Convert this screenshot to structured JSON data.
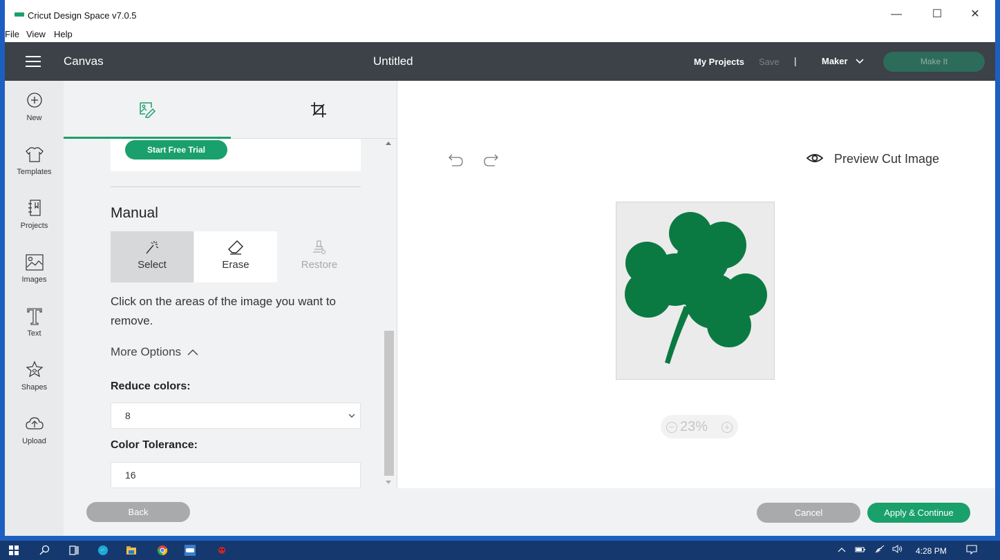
{
  "window": {
    "title": "Cricut Design Space  v7.0.5",
    "menus": [
      "File",
      "View",
      "Help"
    ],
    "controls": {
      "minimize": "—",
      "maximize": "☐",
      "close": "✕"
    }
  },
  "header": {
    "section": "Canvas",
    "doc_title": "Untitled",
    "my_projects": "My Projects",
    "save": "Save",
    "separator": "|",
    "machine": "Maker",
    "make_it": "Make It"
  },
  "sidebar": {
    "items": [
      {
        "label": "New",
        "icon": "plus-circle-icon"
      },
      {
        "label": "Templates",
        "icon": "tshirt-icon"
      },
      {
        "label": "Projects",
        "icon": "notebook-icon"
      },
      {
        "label": "Images",
        "icon": "image-icon"
      },
      {
        "label": "Text",
        "icon": "text-icon"
      },
      {
        "label": "Shapes",
        "icon": "shapes-icon"
      },
      {
        "label": "Upload",
        "icon": "cloud-upload-icon"
      }
    ]
  },
  "panel": {
    "tabs": [
      {
        "icon": "image-edit-icon",
        "active": true
      },
      {
        "icon": "crop-icon",
        "active": false
      }
    ],
    "trial_button": "Start Free Trial",
    "manual_title": "Manual",
    "tools": [
      {
        "label": "Select",
        "icon": "magic-wand-icon",
        "state": "active"
      },
      {
        "label": "Erase",
        "icon": "eraser-icon",
        "state": "normal"
      },
      {
        "label": "Restore",
        "icon": "restore-brush-icon",
        "state": "disabled"
      }
    ],
    "instruction": "Click on the areas of the image you want to remove.",
    "more_options": "More Options",
    "reduce_colors_label": "Reduce colors:",
    "reduce_colors_value": "8",
    "color_tolerance_label": "Color Tolerance:",
    "color_tolerance_value": "16"
  },
  "canvas": {
    "preview_label": "Preview Cut Image",
    "zoom_value": "23%",
    "image_fill": "#0b7a42"
  },
  "footer": {
    "back": "Back",
    "cancel": "Cancel",
    "apply": "Apply & Continue"
  },
  "taskbar": {
    "time": "4:28 PM"
  },
  "colors": {
    "accent": "#1aa06b",
    "header_bg": "#3c4248",
    "shamrock": "#0b7a42"
  }
}
